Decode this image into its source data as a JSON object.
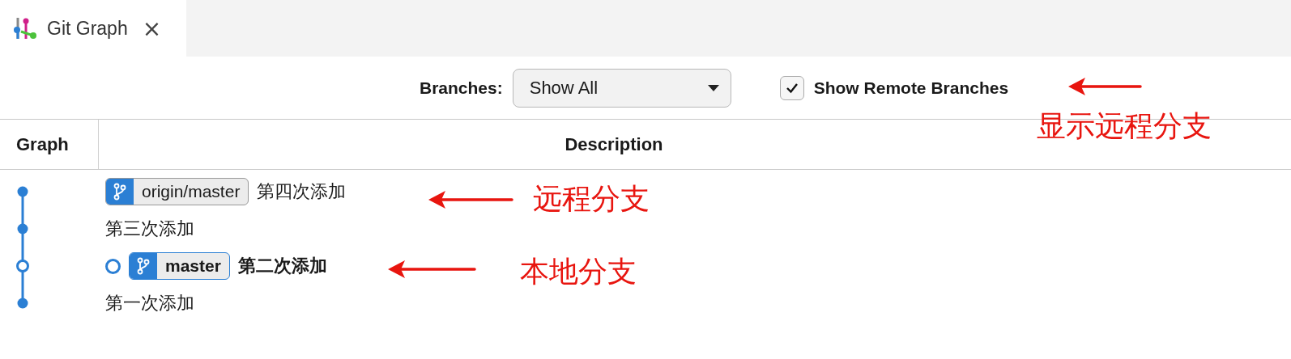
{
  "tab": {
    "title": "Git Graph",
    "close": "×"
  },
  "controls": {
    "branches_label": "Branches:",
    "branches_value": "Show All",
    "show_remote": {
      "label": "Show Remote Branches",
      "checked": true
    }
  },
  "table": {
    "columns": [
      "Graph",
      "Description"
    ],
    "commits": [
      {
        "message": "第四次添加",
        "head": false,
        "refs": [
          {
            "name": "origin/master",
            "kind": "remote"
          }
        ]
      },
      {
        "message": "第三次添加",
        "head": false
      },
      {
        "message": "第二次添加",
        "head": true,
        "refs": [
          {
            "name": "master",
            "kind": "local"
          }
        ]
      },
      {
        "message": "第一次添加",
        "head": false
      }
    ]
  },
  "annotations": [
    {
      "text": "显示远程分支"
    },
    {
      "text": "远程分支"
    },
    {
      "text": "本地分支"
    }
  ]
}
